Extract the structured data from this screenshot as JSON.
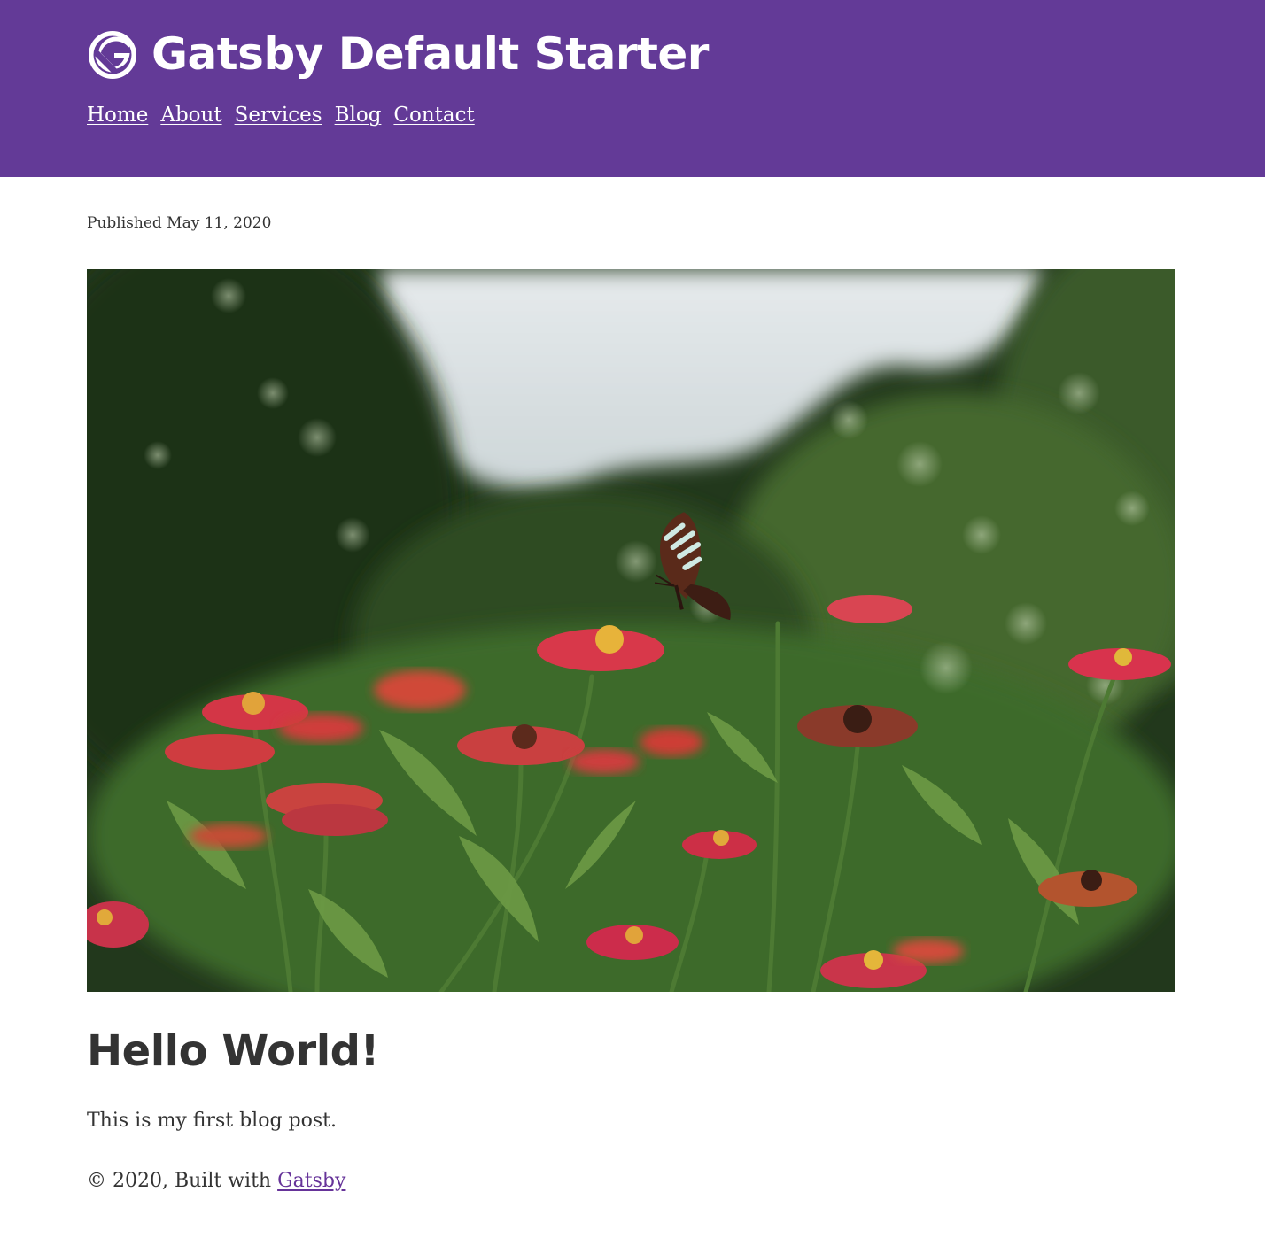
{
  "header": {
    "logo_icon": "gatsby-logo-icon",
    "title": "Gatsby Default Starter",
    "background_color": "#633a97",
    "nav": [
      {
        "label": "Home"
      },
      {
        "label": "About"
      },
      {
        "label": "Services"
      },
      {
        "label": "Blog"
      },
      {
        "label": "Contact"
      }
    ]
  },
  "post": {
    "published": "Published May 11, 2020",
    "hero_image": "butterfly-on-zinnia-flowers-photo",
    "title": "Hello World!",
    "body": "This is my first blog post."
  },
  "footer": {
    "prefix": "© 2020, Built with ",
    "link_label": "Gatsby",
    "link_color": "#663399"
  }
}
